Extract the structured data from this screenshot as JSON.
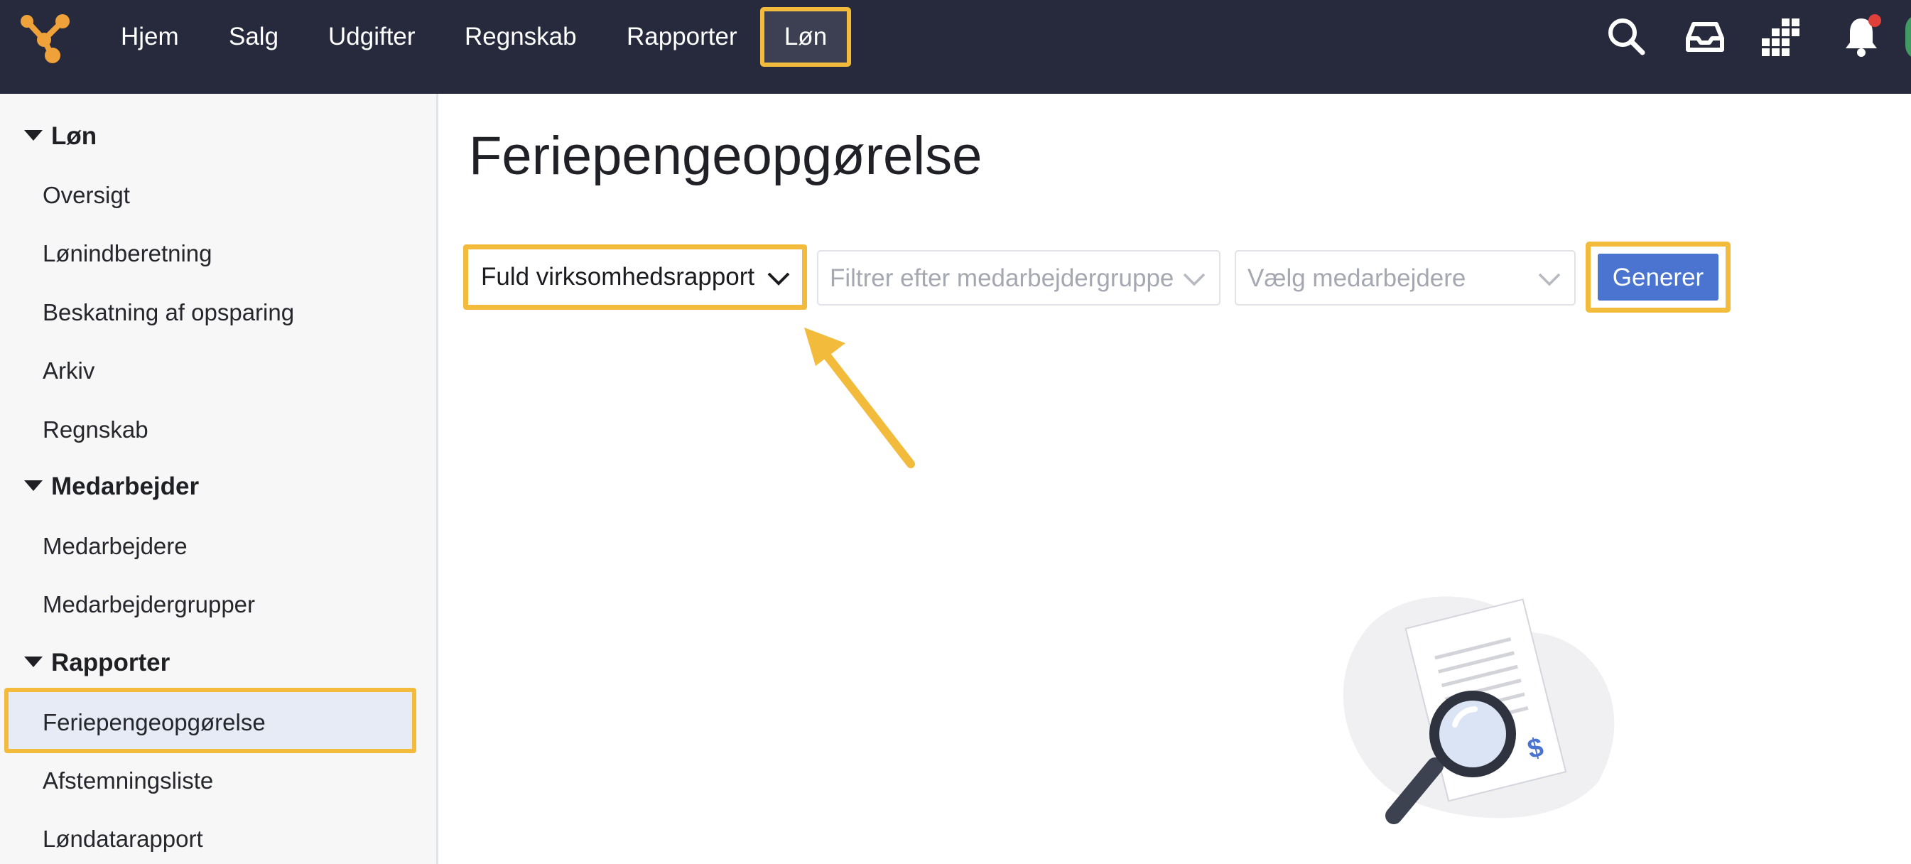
{
  "topnav": {
    "items": [
      {
        "label": "Hjem"
      },
      {
        "label": "Salg"
      },
      {
        "label": "Udgifter"
      },
      {
        "label": "Regnskab"
      },
      {
        "label": "Rapporter"
      }
    ],
    "active_label": "Løn",
    "icons": [
      "search-icon",
      "inbox-icon",
      "apps-grid-icon",
      "bell-icon"
    ]
  },
  "sidebar": {
    "sections": [
      {
        "label": "Løn",
        "items": [
          {
            "label": "Oversigt"
          },
          {
            "label": "Lønindberetning"
          },
          {
            "label": "Beskatning af opsparing"
          },
          {
            "label": "Arkiv"
          },
          {
            "label": "Regnskab"
          }
        ]
      },
      {
        "label": "Medarbejder",
        "items": [
          {
            "label": "Medarbejdere"
          },
          {
            "label": "Medarbejdergrupper"
          }
        ]
      },
      {
        "label": "Rapporter",
        "items": [
          {
            "label": "Feriepengeopgørelse"
          },
          {
            "label": "Afstemningsliste"
          },
          {
            "label": "Løndatarapport"
          }
        ]
      }
    ]
  },
  "main": {
    "title": "Feriepengeopgørelse",
    "report_type": "Fuld virksomhedsrapport",
    "group_filter_placeholder": "Filtrer efter medarbejdergruppe",
    "employee_placeholder": "Vælg medarbejdere",
    "generate_label": "Generer"
  },
  "colors": {
    "topbar": "#272a3d",
    "highlight": "#f2bb3c",
    "primary": "#4a74cf",
    "sidebar_bg": "#f7f7f7",
    "active_item_bg": "#e6ebf5"
  }
}
